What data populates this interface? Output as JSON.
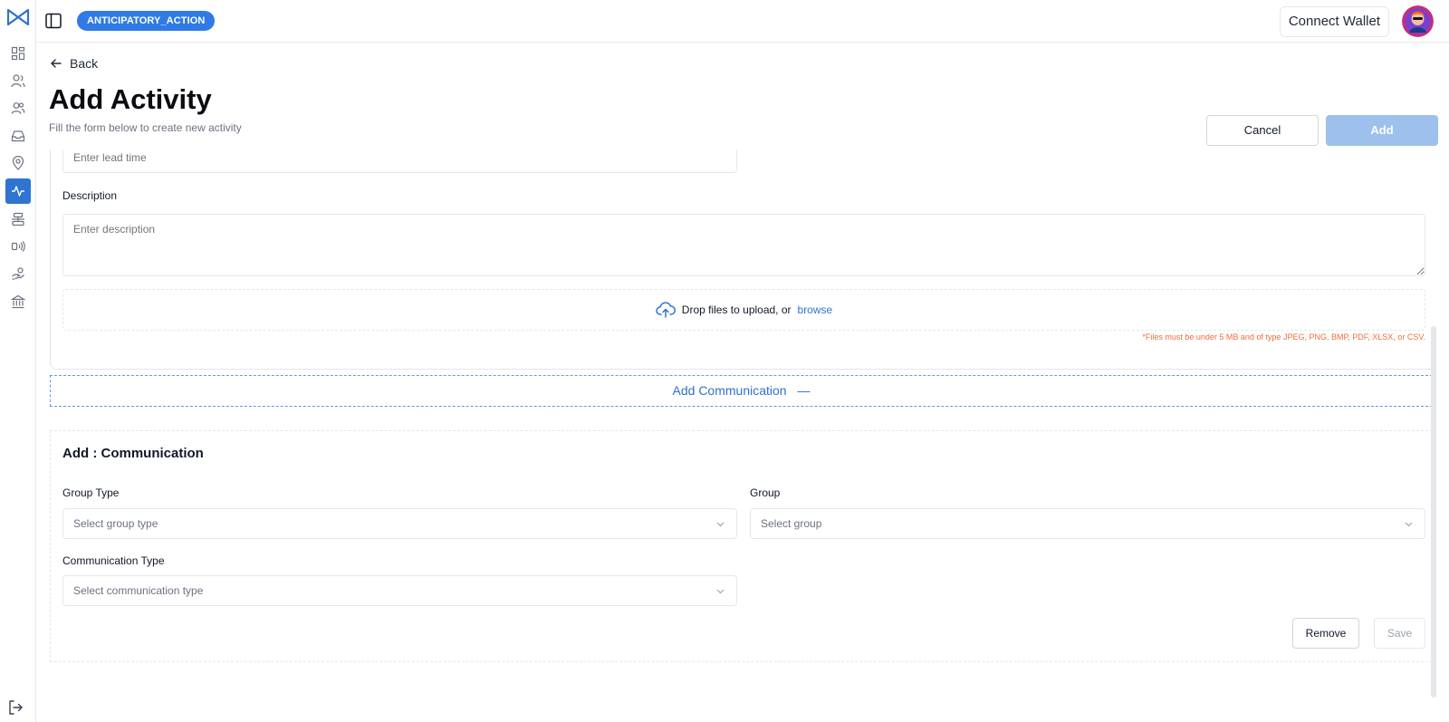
{
  "topbar": {
    "project_badge": "ANTICIPATORY_ACTION",
    "connect_wallet": "Connect Wallet"
  },
  "sidebar": {
    "items": [
      {
        "icon": "dashboard-icon"
      },
      {
        "icon": "beneficiaries-icon"
      },
      {
        "icon": "users-icon"
      },
      {
        "icon": "inbox-icon"
      },
      {
        "icon": "location-pin-icon"
      },
      {
        "icon": "activity-icon",
        "active": true
      },
      {
        "icon": "layers-icon"
      },
      {
        "icon": "broadcast-icon"
      },
      {
        "icon": "hand-coins-icon"
      },
      {
        "icon": "bank-icon"
      }
    ],
    "logout_icon": "logout-icon"
  },
  "page": {
    "back": "Back",
    "title": "Add Activity",
    "subtitle": "Fill the form below to create new activity",
    "cancel": "Cancel",
    "add": "Add"
  },
  "form": {
    "lead_time_placeholder": "Enter lead time",
    "description_label": "Description",
    "description_placeholder": "Enter description",
    "upload_text": "Drop files to upload, or",
    "upload_browse": "browse",
    "file_note": "*Files must be under 5 MB and of type JPEG, PNG, BMP, PDF, XLSX, or CSV."
  },
  "communication": {
    "toggle_label": "Add Communication",
    "toggle_symbol": "—",
    "section_title": "Add : Communication",
    "group_type_label": "Group Type",
    "group_type_placeholder": "Select group type",
    "group_label": "Group",
    "group_placeholder": "Select group",
    "comm_type_label": "Communication Type",
    "comm_type_placeholder": "Select communication type",
    "remove": "Remove",
    "save": "Save"
  },
  "colors": {
    "primary": "#2f74d0",
    "badge": "#2f7ae5",
    "add_button_disabled": "#9dc0ec",
    "warning_text": "#f26c3a"
  }
}
